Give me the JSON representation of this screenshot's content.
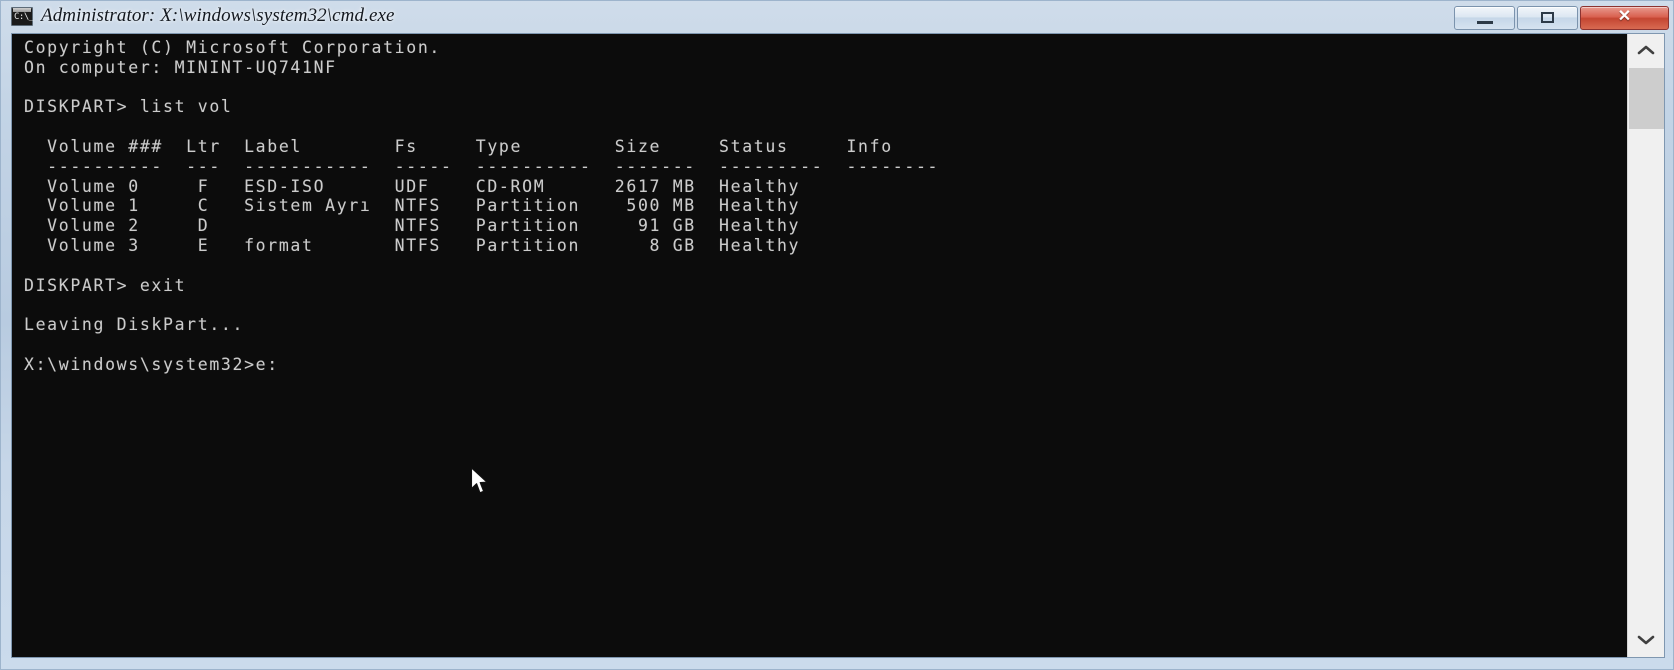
{
  "window": {
    "title": "Administrator: X:\\windows\\system32\\cmd.exe",
    "icon_glyph": "C:\\_",
    "controls": {
      "minimize_label": "",
      "maximize_label": "",
      "close_label": "✕"
    },
    "frame_color": "#b8cbe0",
    "console_background": "#0c0c0c",
    "console_foreground": "#cccccc"
  },
  "console": {
    "lines": [
      "Copyright (C) Microsoft Corporation.",
      "On computer: MININT-UQ741NF",
      "",
      "DISKPART> list vol",
      "",
      "  Volume ###  Ltr  Label        Fs     Type        Size     Status     Info",
      "  ----------  ---  -----------  -----  ----------  -------  ---------  --------",
      "  Volume 0     F   ESD-ISO      UDF    CD-ROM      2617 MB  Healthy",
      "  Volume 1     C   Sistem Ayrı  NTFS   Partition    500 MB  Healthy",
      "  Volume 2     D                NTFS   Partition     91 GB  Healthy",
      "  Volume 3     E   format       NTFS   Partition      8 GB  Healthy",
      "",
      "DISKPART> exit",
      "",
      "Leaving DiskPart...",
      "",
      "X:\\windows\\system32>e:"
    ],
    "text": "Copyright (C) Microsoft Corporation.\nOn computer: MININT-UQ741NF\n\nDISKPART> list vol\n\n  Volume ###  Ltr  Label        Fs     Type        Size     Status     Info\n  ----------  ---  -----------  -----  ----------  -------  ---------  --------\n  Volume 0     F   ESD-ISO      UDF    CD-ROM      2617 MB  Healthy\n  Volume 1     C   Sistem Ayrı  NTFS   Partition    500 MB  Healthy\n  Volume 2     D                NTFS   Partition     91 GB  Healthy\n  Volume 3     E   format       NTFS   Partition      8 GB  Healthy\n\nDISKPART> exit\n\nLeaving DiskPart...\n\nX:\\windows\\system32>e:",
    "volume_table": {
      "headers": [
        "Volume ###",
        "Ltr",
        "Label",
        "Fs",
        "Type",
        "Size",
        "Status",
        "Info"
      ],
      "rows": [
        [
          "Volume 0",
          "F",
          "ESD-ISO",
          "UDF",
          "CD-ROM",
          "2617 MB",
          "Healthy",
          ""
        ],
        [
          "Volume 1",
          "C",
          "Sistem Ayrı",
          "NTFS",
          "Partition",
          "500 MB",
          "Healthy",
          ""
        ],
        [
          "Volume 2",
          "D",
          "",
          "NTFS",
          "Partition",
          "91 GB",
          "Healthy",
          ""
        ],
        [
          "Volume 3",
          "E",
          "format",
          "NTFS",
          "Partition",
          "8 GB",
          "Healthy",
          ""
        ]
      ]
    },
    "commands": [
      "list vol",
      "exit"
    ],
    "prompt_current": "X:\\windows\\system32>e:",
    "computer_name": "MININT-UQ741NF"
  },
  "scrollbar": {
    "up_arrow": "▲",
    "down_arrow": "▼"
  }
}
